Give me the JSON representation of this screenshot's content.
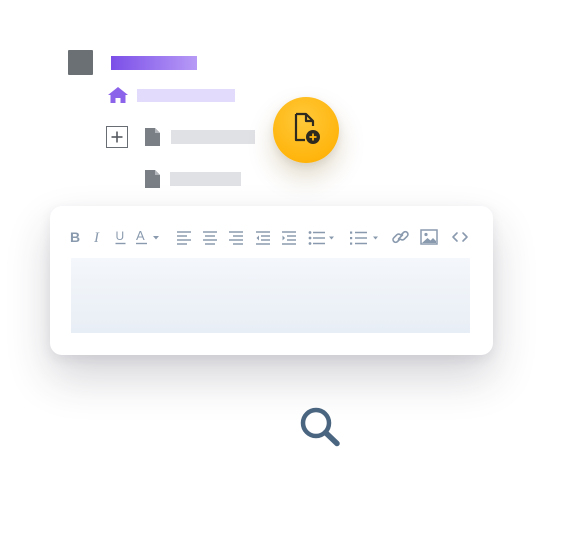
{
  "colors": {
    "accent_purple": "#7b4fe8",
    "accent_purple_light": "#e3dbfb",
    "tree_gray": "#6b7075",
    "placeholder_gray": "#dfe1e4",
    "fab_yellow": "#ffb50d",
    "toolbar_icon": "#8a9aae",
    "editor_bg": "#eef2f7",
    "search_blue": "#4a6580"
  },
  "tree": {
    "root_icon": "square-node-icon",
    "home_icon": "home-icon",
    "expand_icon": "plus-box-icon",
    "document_icon": "document-icon"
  },
  "fab": {
    "icon": "add-document-icon"
  },
  "editor": {
    "toolbar_icons": [
      "bold-icon",
      "italic-icon",
      "underline-icon",
      "font-color-icon",
      "align-left-icon",
      "align-center-icon",
      "align-right-icon",
      "indent-decrease-icon",
      "indent-increase-icon",
      "bullet-list-icon",
      "numbered-list-icon",
      "link-icon",
      "image-icon",
      "code-icon"
    ],
    "toolbar_glyphs": {
      "bold": "B",
      "italic": "I",
      "underline": "U",
      "font_color": "A"
    }
  },
  "search": {
    "icon": "search-icon"
  }
}
